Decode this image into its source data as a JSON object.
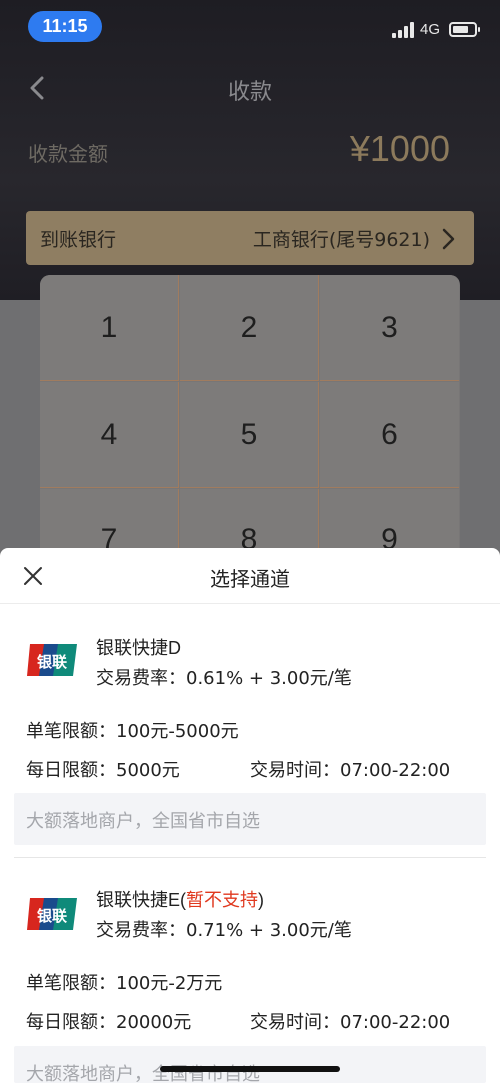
{
  "status_bar": {
    "time": "11:15",
    "network": "4G"
  },
  "nav": {
    "title": "收款"
  },
  "amount": {
    "label": "收款金额",
    "value": "¥1000"
  },
  "bank": {
    "label": "到账银行",
    "value": "工商银行(尾号9621)"
  },
  "keypad": {
    "keys": [
      "1",
      "2",
      "3",
      "4",
      "5",
      "6",
      "7",
      "8",
      "9"
    ]
  },
  "sheet": {
    "title": "选择通道",
    "channels": [
      {
        "name": "银联快捷D",
        "status": "",
        "rate": "交易费率：0.61% + 3.00元/笔",
        "single_limit": "单笔限额：100元-5000元",
        "daily_limit": "每日限额：5000元",
        "time": "交易时间：07:00-22:00",
        "note": "大额落地商户，全国省市自选"
      },
      {
        "name": "银联快捷E(",
        "status": "暂不支持",
        "name_close": ")",
        "rate": "交易费率：0.71% + 3.00元/笔",
        "single_limit": "单笔限额：100元-2万元",
        "daily_limit": "每日限额：20000元",
        "time": "交易时间：07:00-22:00",
        "note": "大额落地商户，全国省市自选"
      }
    ]
  },
  "colors": {
    "accent_gold": "#8f7e62",
    "warning_red": "#e0391f",
    "time_pill": "#2e7bf0"
  },
  "icons": {
    "back": "chevron-left-icon",
    "bank_arrow": "chevron-right-icon",
    "close": "close-icon",
    "logo": "unionpay-logo"
  }
}
